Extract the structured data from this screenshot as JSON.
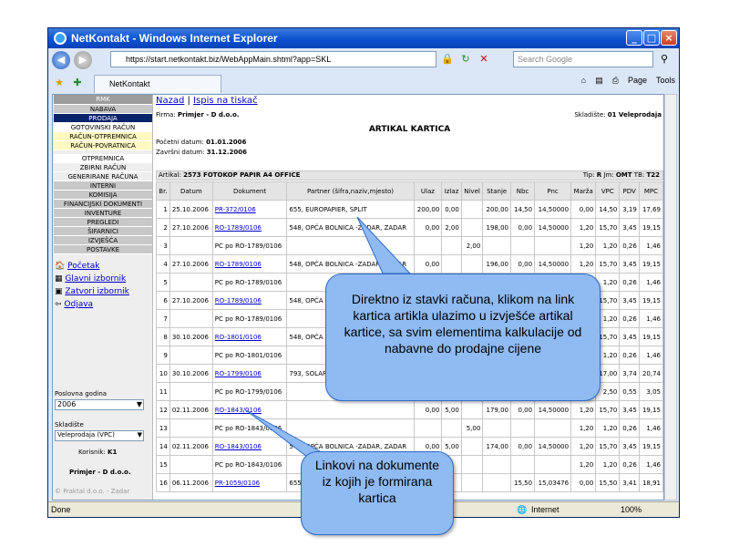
{
  "window": {
    "title": "NetKontakt - Windows Internet Explorer",
    "url": "https://start.netkontakt.biz/WebAppMain.shtml?app=SKL",
    "search_placeholder": "Search Google",
    "tab": "NetKontakt",
    "page": "Page",
    "tools": "Tools"
  },
  "status": {
    "left": "Done",
    "zone": "Internet",
    "zoom": "100%"
  },
  "sidebar": {
    "header": "RMK",
    "items": [
      "NABAVA",
      "PRODAJA",
      "GOTOVINSKI RAČUN",
      "RAČUN-OTPREMNICA",
      "RAČUN-POVRATNICA",
      "OTPREMNICA",
      "ZBIRNI RAČUN",
      "GENERIRANE RAČUNA",
      "INTERNI",
      "KOMISIJA",
      "FINANCIJSKI DOKUMENTI",
      "INVENTURE",
      "PREGLEDI",
      "ŠIFARNICI",
      "IZVJEŠĆA",
      "POSTAVKE"
    ],
    "links": [
      "Početak",
      "Glavni izbornik",
      "Zatvori izbornik",
      "Odjava"
    ],
    "year_label": "Poslovna godina",
    "year_value": "2006",
    "warehouse_label": "Skladište",
    "warehouse_value": "Veleprodaja (VPC)",
    "user_label": "Korisnik:",
    "user_value": "K1",
    "company": "Primjer - D d.o.o.",
    "footer": "© Fraktal d.o.o. - Zadar"
  },
  "main": {
    "back": "Nazad",
    "sep": "|",
    "print": "Ispis na tiskač",
    "firma_label": "Firma:",
    "firma_value": "Primjer - D d.o.o.",
    "skladiste_label": "Skladište:",
    "skladiste_value": "01 Veleprodaja",
    "title": "ARTIKAL KARTICA",
    "start_label": "Početni datum:",
    "start_value": "01.01.2006",
    "end_label": "Završni datum:",
    "end_value": "31.12.2006",
    "artikal_label": "Artikal:",
    "artikal_value": "2573 FOTOKOP PAPIR A4 OFFICE",
    "tip_label": "Tip:",
    "tip_value": "R",
    "jm_label": "Jm:",
    "jm_value": "OMT",
    "tb_label": "TB:",
    "tb_value": "T22"
  },
  "table": {
    "headers": [
      "Br.",
      "Datum",
      "Dokument",
      "Partner (šifra,naziv,mjesto)",
      "Ulaz",
      "Izlaz",
      "Nivel",
      "Stanje",
      "Nbc",
      "Pnc",
      "Marža",
      "VPC",
      "PDV",
      "MPC"
    ],
    "rows": [
      [
        "1",
        "25.10.2006",
        "PR-372/0106",
        "655, EUROPAPIER, SPLIT",
        "200,00",
        "0,00",
        "",
        "200,00",
        "14,50",
        "14,50000",
        "0,00",
        "14,50",
        "3,19",
        "17,69"
      ],
      [
        "2",
        "27.10.2006",
        "RO-1789/0106",
        "548, OPĆA BOLNICA -ZADAR, ZADAR",
        "0,00",
        "2,00",
        "",
        "198,00",
        "0,00",
        "14,50000",
        "1,20",
        "15,70",
        "3,45",
        "19,15"
      ],
      [
        "3",
        "",
        "PC po RO-1789/0106",
        "",
        "",
        "",
        "2,00",
        "",
        "",
        "",
        "1,20",
        "1,20",
        "0,26",
        "1,46"
      ],
      [
        "4",
        "27.10.2006",
        "RO-1789/0106",
        "548, OPĆA BOLNICA -ZADAR, ZADAR",
        "0,00",
        "",
        "",
        "196,00",
        "0,00",
        "14,50000",
        "1,20",
        "15,70",
        "3,45",
        "19,15"
      ],
      [
        "5",
        "",
        "PC po RO-1789/0106",
        "",
        "",
        "",
        "",
        "",
        "",
        "",
        "",
        "1,20",
        "0,26",
        "1,46"
      ],
      [
        "6",
        "27.10.2006",
        "RO-1789/0106",
        "548, OPĆA BOLNICA -ZADAR, ZADAR",
        "",
        "",
        "",
        "",
        "",
        "",
        "",
        "15,70",
        "3,45",
        "19,15"
      ],
      [
        "7",
        "",
        "PC po RO-1789/0106",
        "",
        "",
        "",
        "",
        "",
        "",
        "",
        "",
        "1,20",
        "0,26",
        "1,46"
      ],
      [
        "8",
        "30.10.2006",
        "RO-1801/0106",
        "548, OPĆA BOLNICA -ZADAR, ZADAR",
        "",
        "",
        "",
        "",
        "",
        "",
        "",
        "15,70",
        "3,45",
        "19,15"
      ],
      [
        "9",
        "",
        "PC po RO-1801/0106",
        "",
        "",
        "",
        "",
        "",
        "",
        "",
        "",
        "1,20",
        "0,26",
        "1,46"
      ],
      [
        "10",
        "30.10.2006",
        "RO-1799/0106",
        "793, SOLARIS D ŠIBENIK",
        "",
        "",
        "",
        "",
        "",
        "",
        "",
        "17,00",
        "3,74",
        "20,74"
      ],
      [
        "11",
        "",
        "PC po RO-1799/0106",
        "",
        "",
        "",
        "",
        "",
        "",
        "",
        "",
        "2,50",
        "0,55",
        "3,05"
      ],
      [
        "12",
        "02.11.2006",
        "RO-1843/0106",
        "",
        "0,00",
        "5,00",
        "",
        "179,00",
        "0,00",
        "14,50000",
        "1,20",
        "15,70",
        "3,45",
        "19,15"
      ],
      [
        "13",
        "",
        "PC po RO-1843/0106",
        "",
        "",
        "",
        "5,00",
        "",
        "",
        "",
        "1,20",
        "1,20",
        "0,26",
        "1,46"
      ],
      [
        "14",
        "02.11.2006",
        "RO-1843/0106",
        "548, OPĆA BOLNICA -ZADAR, ZADAR",
        "0,00",
        "5,00",
        "",
        "174,00",
        "0,00",
        "14,50000",
        "1,20",
        "15,70",
        "3,45",
        "19,15"
      ],
      [
        "15",
        "",
        "PC po RO-1843/0106",
        "",
        "",
        "",
        "",
        "",
        "",
        "",
        "1,20",
        "1,20",
        "0,26",
        "1,46"
      ],
      [
        "16",
        "06.11.2006",
        "PR-1059/0106",
        "655, EURO SPLIT",
        "",
        "",
        "",
        "",
        "15,50",
        "15,03476",
        "0,00",
        "15,50",
        "3,41",
        "18,91"
      ]
    ]
  },
  "callouts": {
    "big": "Direktno iz stavki računa, klikom na link kartica artikla ulazimo u izvješće artikal kartice, sa svim elementima kalkulacije od nabavne do prodajne cijene",
    "small": "Linkovi na dokumente iz kojih je formirana kartica"
  },
  "colors": {
    "title_bar": "#0a4fd0",
    "selected_menu": "#0a246a",
    "callout": "#8fbaf2",
    "link": "#0000cc"
  }
}
